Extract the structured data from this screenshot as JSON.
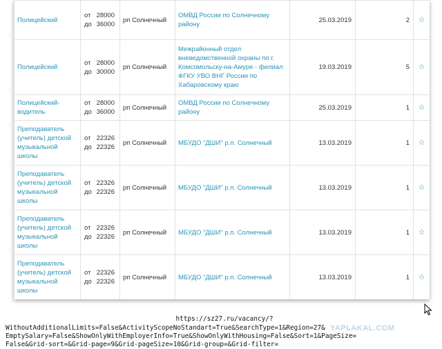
{
  "rows": [
    {
      "title": "Полицейский",
      "salary_from_label": "от",
      "salary_from": "28000",
      "salary_to_label": "до",
      "salary_to": "36000",
      "location": "рп Солнечный",
      "employer": "ОМВД России по Солнечному району",
      "date": "25.03.2019",
      "count": "2",
      "fav": "☆"
    },
    {
      "title": "Полицейский",
      "salary_from_label": "от",
      "salary_from": "28000",
      "salary_to_label": "до",
      "salary_to": "30000",
      "location": "рп Солнечный",
      "employer": "Межрайонный отдел вневедомственной охраны по г. Комсомольску-на-Амуре - филиал ФГКУ УВО ВНГ России по Хабаровскому краю",
      "date": "19.03.2019",
      "count": "5",
      "fav": "☆"
    },
    {
      "title": "Полицейский-водитель",
      "salary_from_label": "от",
      "salary_from": "28000",
      "salary_to_label": "до",
      "salary_to": "36000",
      "location": "рп Солнечный",
      "employer": "ОМВД России по Солнечному району",
      "date": "25.03.2019",
      "count": "1",
      "fav": "☆"
    },
    {
      "title": "Преподаватель (учитель) детской музыкальной школы",
      "salary_from_label": "от",
      "salary_from": "22326",
      "salary_to_label": "до",
      "salary_to": "22326",
      "location": "рп Солнечный",
      "employer": "МБУДО \"ДШИ\" р.п. Солнечный",
      "date": "13.03.2019",
      "count": "1",
      "fav": "☆"
    },
    {
      "title": "Преподаватель (учитель) детской музыкальной школы",
      "salary_from_label": "от",
      "salary_from": "22326",
      "salary_to_label": "до",
      "salary_to": "22326",
      "location": "рп Солнечный",
      "employer": "МБУДО \"ДШИ\" р.п. Солнечный",
      "date": "13.03.2019",
      "count": "1",
      "fav": "☆"
    },
    {
      "title": "Преподаватель (учитель) детской музыкальной школы",
      "salary_from_label": "от",
      "salary_from": "22326",
      "salary_to_label": "до",
      "salary_to": "22326",
      "location": "рп Солнечный",
      "employer": "МБУДО \"ДШИ\" р.п. Солнечный",
      "date": "13.03.2019",
      "count": "1",
      "fav": "☆"
    },
    {
      "title": "Преподаватель (учитель) детской музыкальной школы",
      "salary_from_label": "от",
      "salary_from": "22326",
      "salary_to_label": "до",
      "salary_to": "22326",
      "location": "рп Солнечный",
      "employer": "МБУДО \"ДШИ\" р.п. Солнечный",
      "date": "13.03.2019",
      "count": "1",
      "fav": "☆"
    }
  ],
  "caption": {
    "url": "https://sz27.ru/vacancy/?",
    "line1": "WithoutAdditionalLimits=False&ActivityScopeNoStandart=True&SearchType=1&Region=27&",
    "line2": "EmptySalary=False&ShowOnlyWithEmployerInfo=True&ShowOnlyWithHousing=False&Sort=1&PageSize=",
    "line3": "False&Grid-sort=&Grid-page=9&Grid-pageSize=10&Grid-group=&Grid-filter="
  },
  "watermark": "YAPLAKAL.COM",
  "icons": {
    "favorite": "star-outline-icon",
    "cursor": "mouse-pointer-icon"
  }
}
